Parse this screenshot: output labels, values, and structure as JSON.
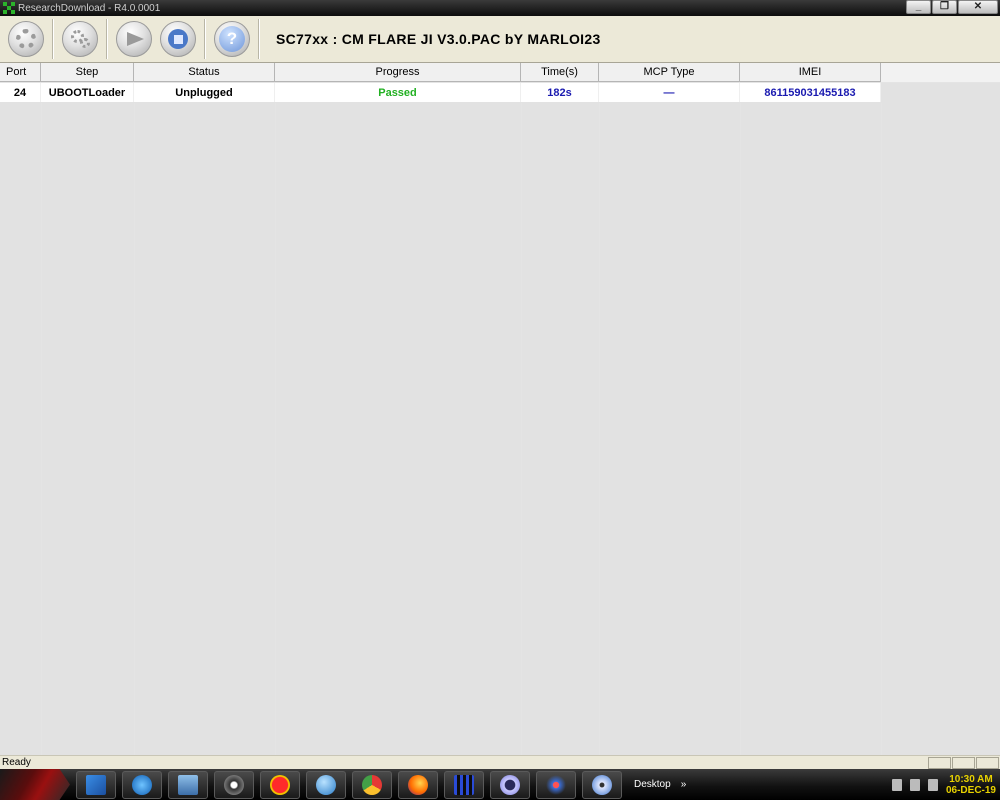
{
  "window": {
    "title": "ResearchDownload - R4.0.0001",
    "minimize": "_",
    "restore": "❐",
    "close": "✕"
  },
  "toolbar": {
    "buttons": [
      {
        "icon": "gear-icon"
      },
      {
        "icon": "gears-icon"
      },
      {
        "icon": "start-arrow-icon"
      },
      {
        "icon": "stop-icon"
      },
      {
        "icon": "help-icon",
        "glyph": "?"
      }
    ],
    "pac_title": "SC77xx : CM FLARE JI V3.0.PAC bY MARLOI23"
  },
  "table": {
    "headers": [
      "Port",
      "Step",
      "Status",
      "Progress",
      "Time(s)",
      "MCP Type",
      "IMEI"
    ],
    "rows": [
      {
        "port": "24",
        "step": "UBOOTLoader",
        "status": "Unplugged",
        "progress": "Passed",
        "time": "182s",
        "mcp": "—",
        "imei": "861159031455183"
      }
    ],
    "colors": {
      "progress": "#22b022",
      "time": "#1a1ab0",
      "mcp": "#1a1ab0",
      "imei": "#1a1ab0"
    }
  },
  "statusbar": {
    "text": "Ready"
  },
  "taskbar": {
    "desktop_label": "Desktop",
    "chevron": "»",
    "clock_time": "10:30 AM",
    "clock_date": "06-DEC-19"
  }
}
